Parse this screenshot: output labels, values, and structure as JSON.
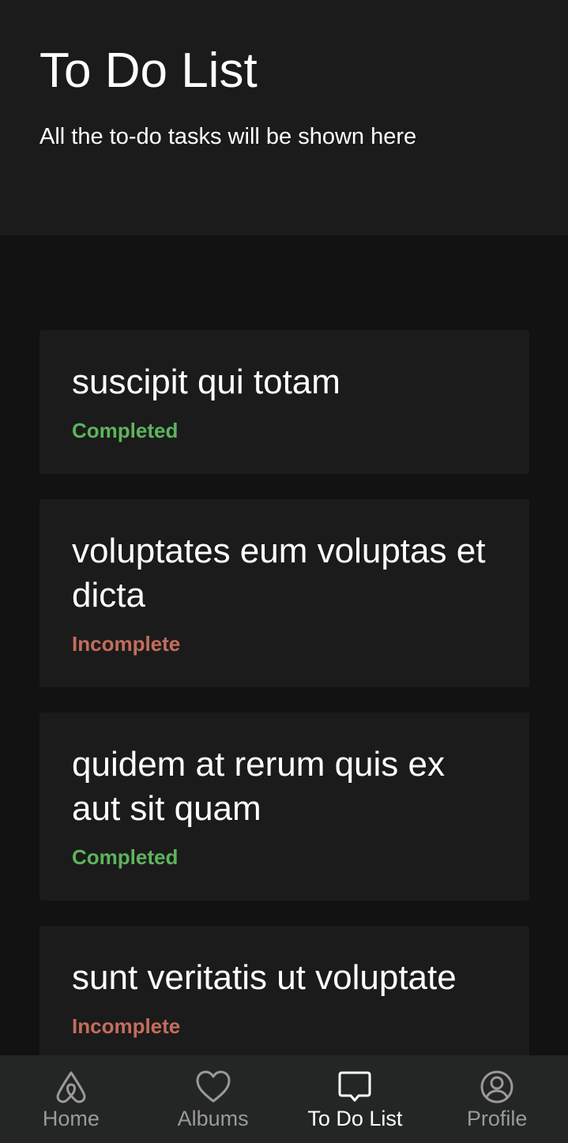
{
  "header": {
    "title": "To Do List",
    "subtitle": "All the to-do tasks will be shown here"
  },
  "todos": [
    {
      "title": "suscipit qui totam",
      "status": "Completed",
      "completed": true
    },
    {
      "title": "voluptates eum voluptas et dicta",
      "status": "Incomplete",
      "completed": false
    },
    {
      "title": "quidem at rerum quis ex aut sit quam",
      "status": "Completed",
      "completed": true
    },
    {
      "title": "sunt veritatis ut voluptate",
      "status": "Incomplete",
      "completed": false
    }
  ],
  "nav": {
    "items": [
      {
        "label": "Home",
        "icon": "airbnb-logo-icon",
        "active": false
      },
      {
        "label": "Albums",
        "icon": "heart-icon",
        "active": false
      },
      {
        "label": "To Do List",
        "icon": "chat-bubble-icon",
        "active": true
      },
      {
        "label": "Profile",
        "icon": "user-circle-icon",
        "active": false
      }
    ]
  },
  "colors": {
    "header_bg": "#1b1b1b",
    "page_bg": "#121212",
    "card_bg": "#1b1b1b",
    "completed": "#5db45c",
    "incomplete": "#c46d5c",
    "nav_bg": "#242525",
    "nav_inactive": "#9a9a9a",
    "nav_active": "#ffffff"
  }
}
